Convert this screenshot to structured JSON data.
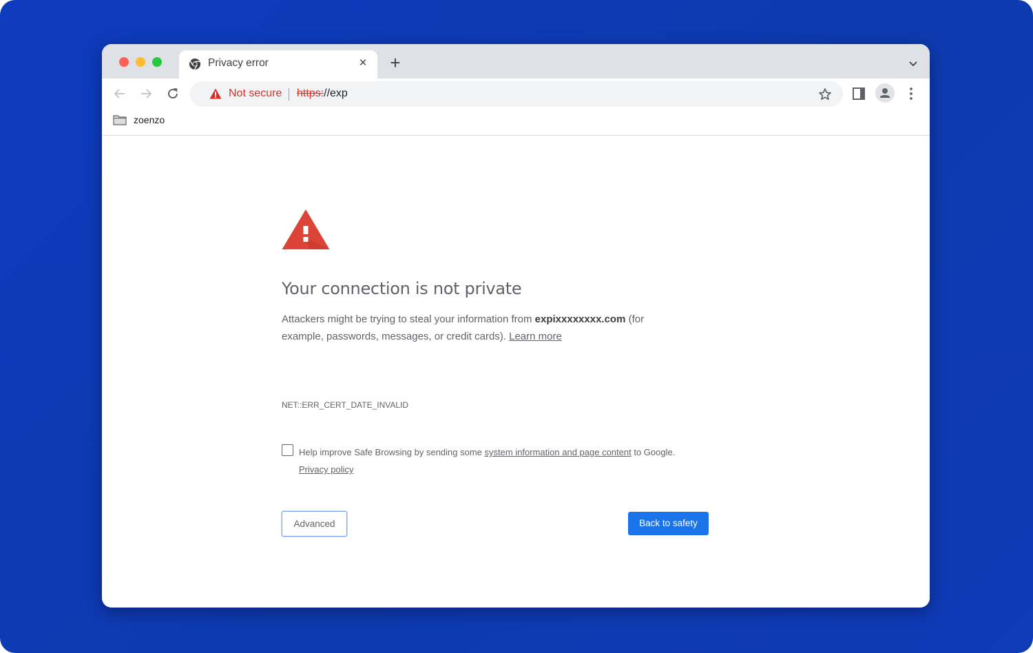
{
  "colors": {
    "backdrop": "#0d3bbd",
    "accent": "#1a73e8",
    "warning_red": "#d93025",
    "warning_icon_red": "#db4437"
  },
  "browser": {
    "tab": {
      "title": "Privacy error",
      "favicon": "chrome-icon",
      "close_label": "×"
    },
    "new_tab_label": "+",
    "toolbar": {
      "back_icon": "arrow-left-icon",
      "forward_icon": "arrow-right-icon",
      "reload_icon": "reload-icon",
      "security_label": "Not secure",
      "url_scheme": "https:",
      "url_rest": "//exp",
      "bookmark_icon": "star-icon",
      "side_panel_icon": "side-panel-icon",
      "profile_icon": "person-icon",
      "menu_icon": "kebab-menu-icon"
    },
    "bookmarks": [
      {
        "label": "zoenzo",
        "icon": "folder-icon"
      }
    ]
  },
  "page": {
    "heading": "Your connection is not private",
    "description_before": "Attackers might be trying to steal your information from ",
    "domain": "expixxxxxxxx.com",
    "description_after": " (for example, passwords, messages, or credit cards). ",
    "learn_more": "Learn more",
    "error_code": "NET::ERR_CERT_DATE_INVALID",
    "optin": {
      "checked": false,
      "text_before": "Help improve Safe Browsing by sending some ",
      "link": "system information and page content",
      "text_after": " to Google.",
      "privacy_link": "Privacy policy"
    },
    "advanced_button": "Advanced",
    "back_button": "Back to safety"
  }
}
